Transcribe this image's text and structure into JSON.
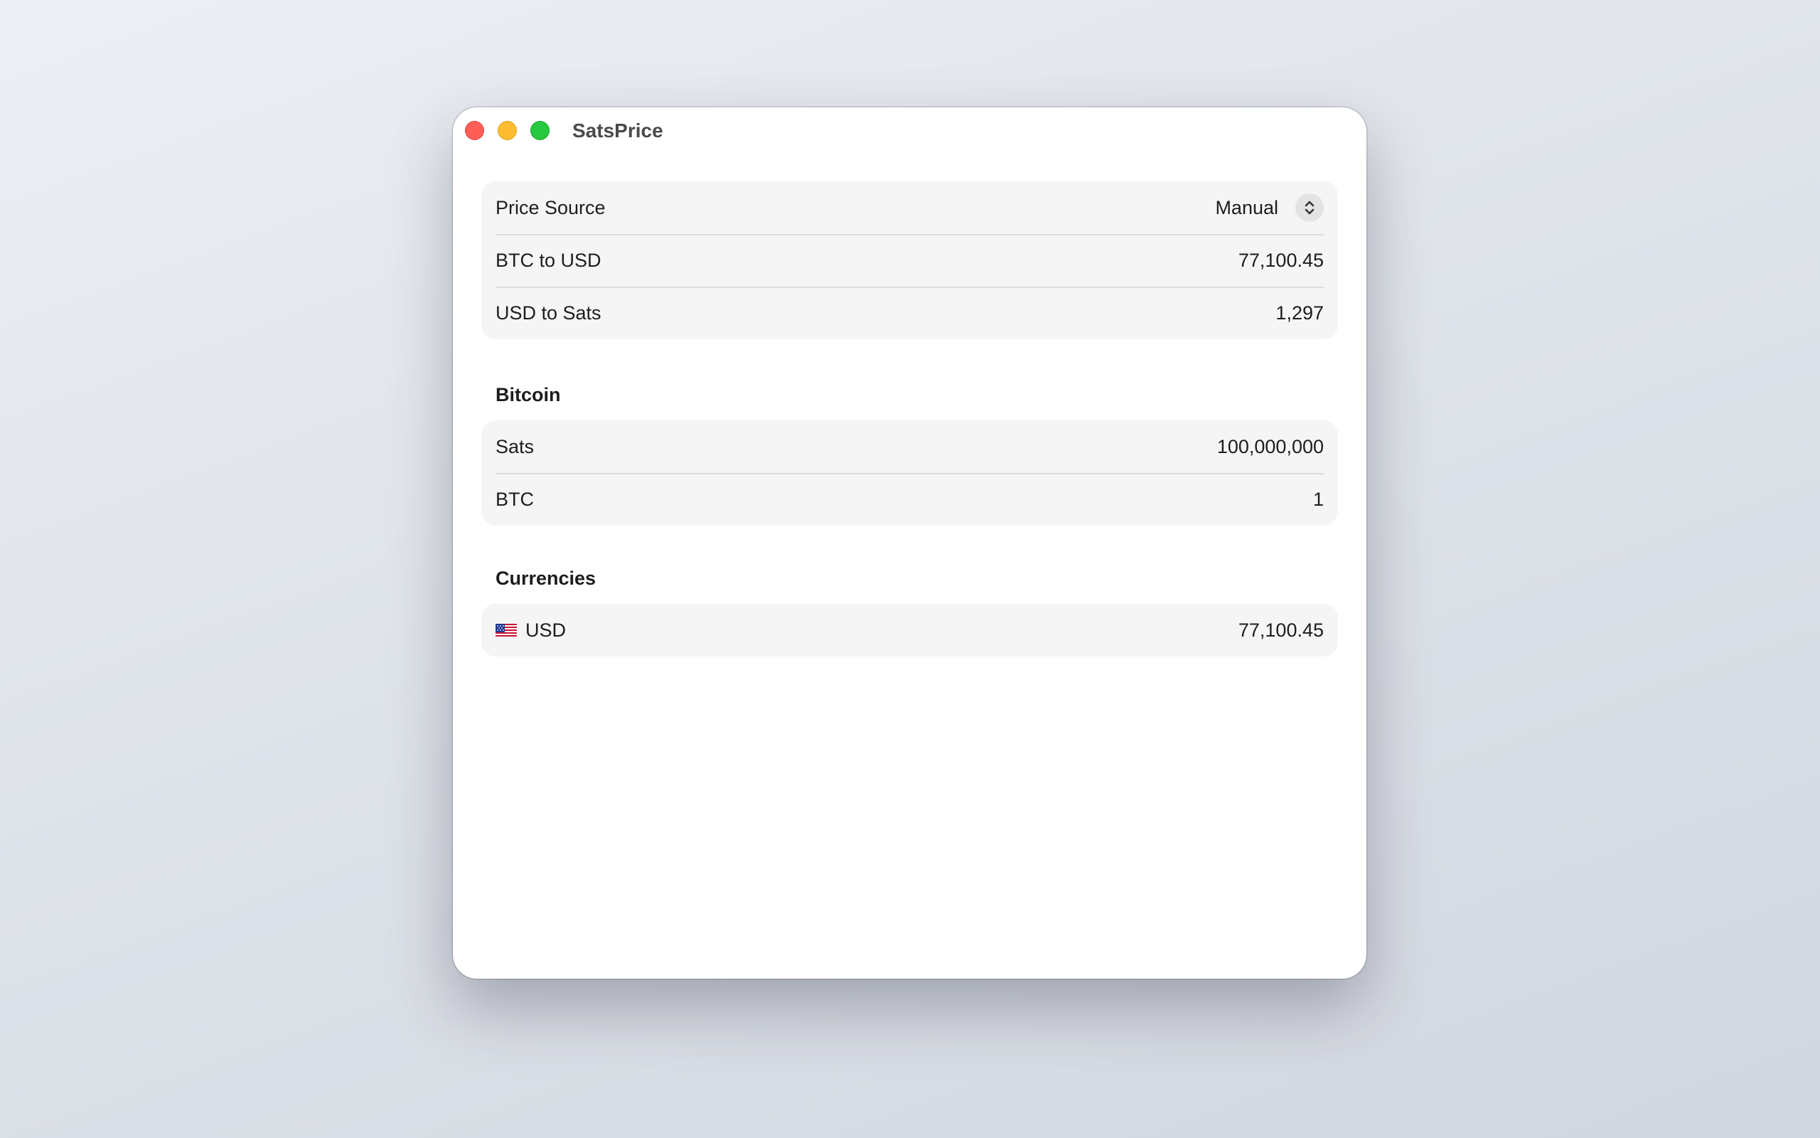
{
  "window": {
    "title": "SatsPrice"
  },
  "price_group": {
    "source_label": "Price Source",
    "source_value": "Manual",
    "btc_usd_label": "BTC to USD",
    "btc_usd_value": "77,100.45",
    "usd_sats_label": "USD to Sats",
    "usd_sats_value": "1,297"
  },
  "bitcoin": {
    "header": "Bitcoin",
    "sats_label": "Sats",
    "sats_value": "100,000,000",
    "btc_label": "BTC",
    "btc_value": "1"
  },
  "currencies": {
    "header": "Currencies",
    "items": [
      {
        "flag_icon": "us-flag-icon",
        "code": "USD",
        "value": "77,100.45"
      }
    ]
  },
  "colors": {
    "close": "#ff5f57",
    "minimize": "#febc2e",
    "zoom": "#28c840"
  }
}
